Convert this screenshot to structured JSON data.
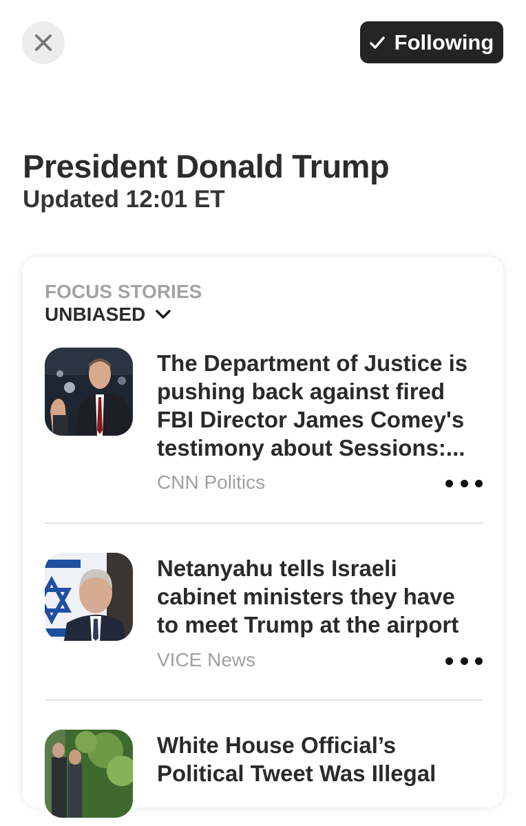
{
  "header": {
    "close_icon": "close-icon",
    "follow_button": {
      "label": "Following",
      "icon": "checkmark-icon"
    }
  },
  "topic": {
    "title": "President Donald Trump",
    "updated": "Updated 12:01 ET"
  },
  "focus": {
    "section_label": "FOCUS STORIES",
    "filter_label": "UNBIASED",
    "filter_icon": "chevron-down-icon",
    "stories": [
      {
        "headline": "The Department of Justice is pushing back against fired FBI Director James Comey's testimony about Sessions:...",
        "source": "CNN Politics"
      },
      {
        "headline": "Netanyahu tells Israeli cabinet ministers they have to meet Trump at the airport",
        "source": "VICE News"
      },
      {
        "headline": "White House Official’s Political Tweet Was Illegal",
        "source": ""
      }
    ]
  },
  "colors": {
    "follow_bg": "#242424",
    "close_bg": "#ececec",
    "muted_text": "#a0a0a0",
    "divider": "#e3e3e3"
  }
}
